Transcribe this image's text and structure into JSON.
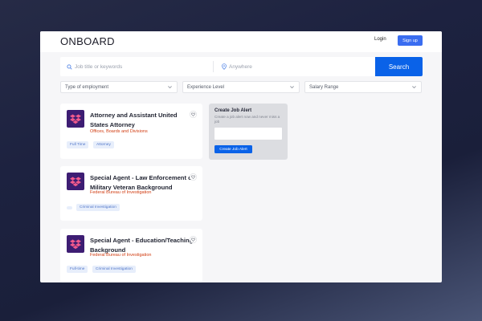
{
  "header": {
    "logo": "ONBOARD",
    "login_label": "Login",
    "signup_label": "Sign up"
  },
  "search": {
    "keywords_placeholder": "Job title or keywords",
    "location_placeholder": "Anywhere",
    "button_label": "Search"
  },
  "filters": [
    {
      "label": "Type of employment"
    },
    {
      "label": "Experience Level"
    },
    {
      "label": "Salary Range"
    }
  ],
  "jobs": [
    {
      "title": "Attorney and Assistant United States Attorney",
      "org": "Offices, Boards and Divisions",
      "tags": [
        "Full Time",
        "Attorney"
      ]
    },
    {
      "title": "Special Agent - Law Enforcement or Military Veteran Background",
      "org": "Federal Bureau of Investigation",
      "tags": [
        "Criminal Investigation"
      ]
    },
    {
      "title": "Special Agent - Education/Teaching Background",
      "org": "Federal Bureau of Investigation",
      "tags": [
        "Full-time",
        "Criminal Investigation"
      ]
    }
  ],
  "job_alert": {
    "title": "Create Job Alert",
    "description": "Create a job alert now and never miss a job",
    "button_label": "Create Job Alert"
  },
  "colors": {
    "primary": "#0a62e8",
    "org_text": "#d13d12",
    "logo_bg": "#3d1d73"
  },
  "icons": [
    "search-icon",
    "location-pin-icon",
    "chevron-down-icon",
    "heart-icon",
    "dropbox-icon"
  ]
}
